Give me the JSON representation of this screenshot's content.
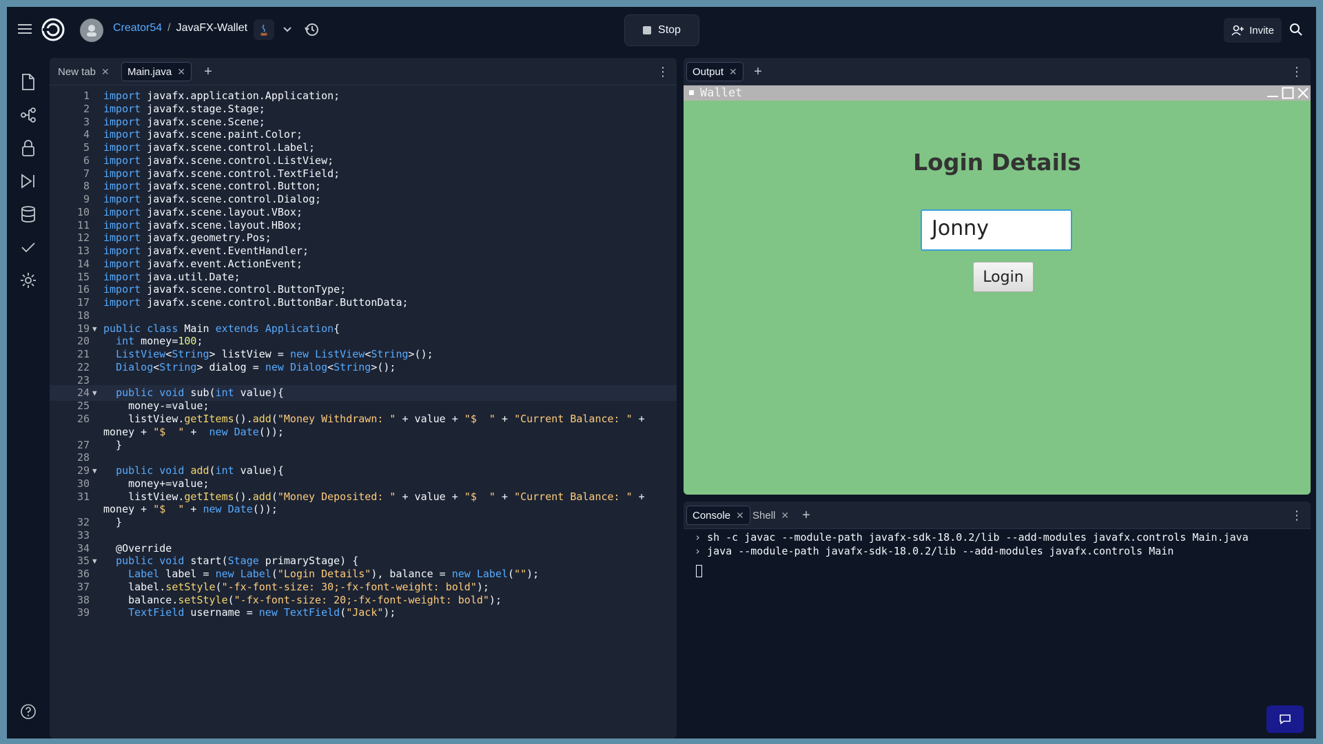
{
  "topbar": {
    "user": "Creator54",
    "separator": "/",
    "repl_name": "JavaFX-Wallet",
    "stop_label": "Stop",
    "invite_label": "Invite"
  },
  "editor": {
    "tabs": [
      {
        "label": "New tab"
      },
      {
        "label": "Main.java"
      }
    ],
    "lines": [
      {
        "n": "1",
        "t": "import javafx.application.Application;"
      },
      {
        "n": "2",
        "t": "import javafx.stage.Stage;"
      },
      {
        "n": "3",
        "t": "import javafx.scene.Scene;"
      },
      {
        "n": "4",
        "t": "import javafx.scene.paint.Color;"
      },
      {
        "n": "5",
        "t": "import javafx.scene.control.Label;"
      },
      {
        "n": "6",
        "t": "import javafx.scene.control.ListView;"
      },
      {
        "n": "7",
        "t": "import javafx.scene.control.TextField;"
      },
      {
        "n": "8",
        "t": "import javafx.scene.control.Button;"
      },
      {
        "n": "9",
        "t": "import javafx.scene.control.Dialog;"
      },
      {
        "n": "10",
        "t": "import javafx.scene.layout.VBox;"
      },
      {
        "n": "11",
        "t": "import javafx.scene.layout.HBox;"
      },
      {
        "n": "12",
        "t": "import javafx.geometry.Pos;"
      },
      {
        "n": "13",
        "t": "import javafx.event.EventHandler;"
      },
      {
        "n": "14",
        "t": "import javafx.event.ActionEvent;"
      },
      {
        "n": "15",
        "t": "import java.util.Date;"
      },
      {
        "n": "16",
        "t": "import javafx.scene.control.ButtonType;"
      },
      {
        "n": "17",
        "t": "import javafx.scene.control.ButtonBar.ButtonData;"
      },
      {
        "n": "18",
        "t": ""
      },
      {
        "n": "19",
        "t": "public class Main extends Application{"
      },
      {
        "n": "20",
        "t": "  int money=100;"
      },
      {
        "n": "21",
        "t": "  ListView<String> listView = new ListView<String>();"
      },
      {
        "n": "22",
        "t": "  Dialog<String> dialog = new Dialog<String>();"
      },
      {
        "n": "23",
        "t": ""
      },
      {
        "n": "24",
        "t": "  public void sub(int value){"
      },
      {
        "n": "25",
        "t": "    money-=value;"
      },
      {
        "n": "26",
        "t": "    listView.getItems().add(\"Money Withdrawn: \" + value + \"$  \" + \"Current Balance: \" +"
      },
      {
        "n": "",
        "t": "money + \"$  \" +  new Date());"
      },
      {
        "n": "27",
        "t": "  }"
      },
      {
        "n": "28",
        "t": ""
      },
      {
        "n": "29",
        "t": "  public void add(int value){"
      },
      {
        "n": "30",
        "t": "    money+=value;"
      },
      {
        "n": "31",
        "t": "    listView.getItems().add(\"Money Deposited: \" + value + \"$  \" + \"Current Balance: \" +"
      },
      {
        "n": "",
        "t": "money + \"$  \" + new Date());"
      },
      {
        "n": "32",
        "t": "  }"
      },
      {
        "n": "33",
        "t": ""
      },
      {
        "n": "34",
        "t": "  @Override"
      },
      {
        "n": "35",
        "t": "  public void start(Stage primaryStage) {"
      },
      {
        "n": "36",
        "t": "    Label label = new Label(\"Login Details\"), balance = new Label(\"\");"
      },
      {
        "n": "37",
        "t": "    label.setStyle(\"-fx-font-size: 30;-fx-font-weight: bold\");"
      },
      {
        "n": "38",
        "t": "    balance.setStyle(\"-fx-font-size: 20;-fx-font-weight: bold\");"
      },
      {
        "n": "39",
        "t": "    TextField username = new TextField(\"Jack\");"
      }
    ]
  },
  "output": {
    "tab_label": "Output",
    "window_title": "Wallet",
    "heading": "Login Details",
    "username_value": "Jonny",
    "login_label": "Login"
  },
  "console": {
    "tabs": [
      {
        "label": "Console"
      },
      {
        "label": "Shell"
      }
    ],
    "lines": [
      "sh -c javac --module-path javafx-sdk-18.0.2/lib --add-modules javafx.controls Main.java",
      "java --module-path javafx-sdk-18.0.2/lib --add-modules javafx.controls Main"
    ]
  },
  "colors": {
    "app_bg": "#0e1525",
    "pane_bg": "#1c2333",
    "accent": "#57abff",
    "output_bg": "#80c585"
  },
  "icons": {
    "rail": [
      "files-icon",
      "git-icon",
      "lock-icon",
      "run-icon",
      "database-icon",
      "check-icon",
      "settings-icon",
      "help-icon"
    ]
  }
}
